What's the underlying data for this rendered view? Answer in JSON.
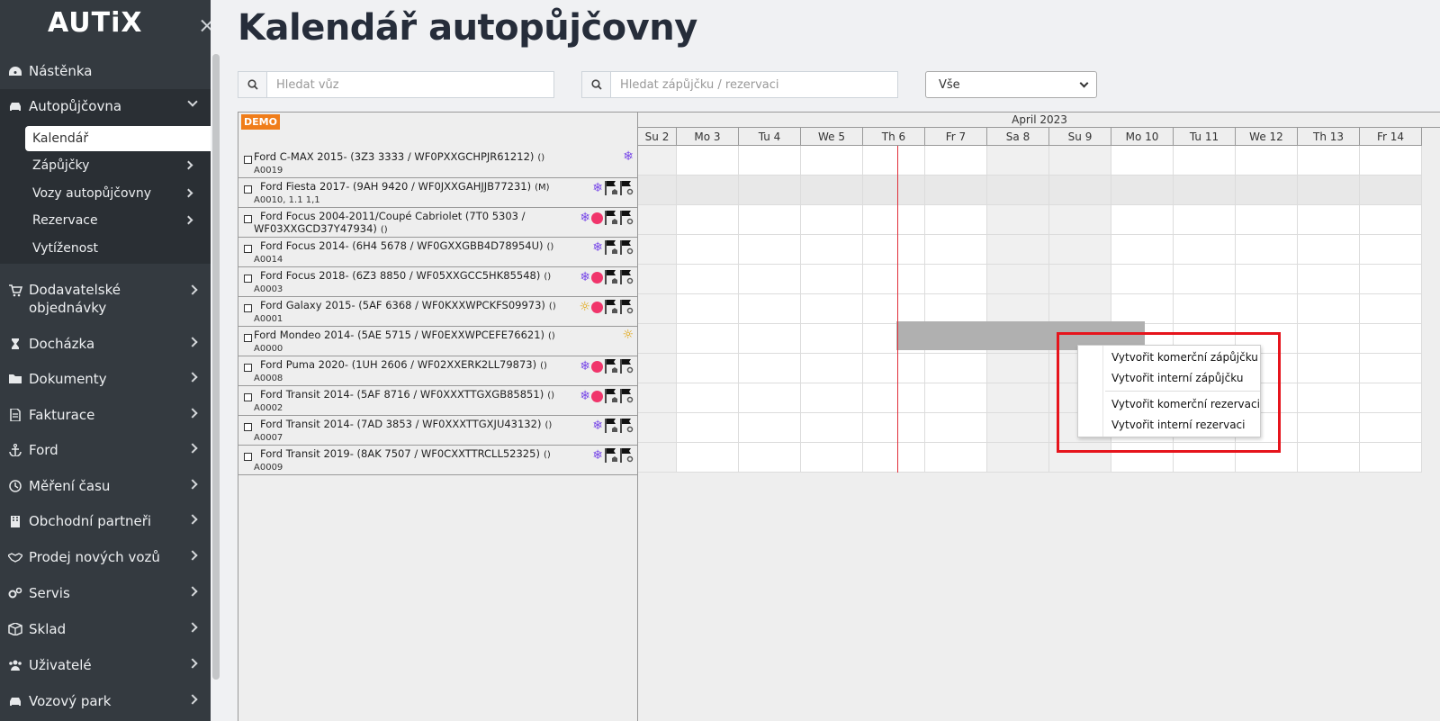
{
  "sidebar": {
    "logo": "AUTiX",
    "items": [
      {
        "label": "Nástěnka",
        "icon": "gauge-icon"
      },
      {
        "label": "Autopůjčovna",
        "icon": "car-icon"
      },
      {
        "label": "Dodavatelské objednávky",
        "icon": "cart-icon"
      },
      {
        "label": "Docházka",
        "icon": "hourglass-icon"
      },
      {
        "label": "Dokumenty",
        "icon": "folder-icon"
      },
      {
        "label": "Fakturace",
        "icon": "document-icon"
      },
      {
        "label": "Ford",
        "icon": "anchor-icon"
      },
      {
        "label": "Měření času",
        "icon": "clock-icon"
      },
      {
        "label": "Obchodní partneři",
        "icon": "building-icon"
      },
      {
        "label": "Prodej nových vozů",
        "icon": "handshake-icon"
      },
      {
        "label": "Servis",
        "icon": "gears-icon"
      },
      {
        "label": "Sklad",
        "icon": "box-icon"
      },
      {
        "label": "Uživatelé",
        "icon": "users-icon"
      },
      {
        "label": "Vozový park",
        "icon": "car-icon"
      }
    ],
    "sub_items": [
      {
        "label": "Kalendář"
      },
      {
        "label": "Zápůjčky"
      },
      {
        "label": "Vozy autopůjčovny"
      },
      {
        "label": "Rezervace"
      },
      {
        "label": "Vytíženost"
      }
    ]
  },
  "page": {
    "title": "Kalendář autopůjčovny"
  },
  "search": {
    "car_placeholder": "Hledat vůz",
    "loan_placeholder": "Hledat zápůjčku / rezervaci",
    "filter_value": "Vše"
  },
  "calendar": {
    "demo_label": "DEMO",
    "month": "April 2023",
    "days": [
      "Su 2",
      "Mo 3",
      "Tu 4",
      "We 5",
      "Th 6",
      "Fr 7",
      "Sa 8",
      "Su 9",
      "Mo 10",
      "Tu 11",
      "We 12",
      "Th 13",
      "Fr 14"
    ],
    "cars": [
      {
        "name": "Ford C-MAX 2015- (3Z3 3333 / WF0PXXGCHPJR61212)",
        "suffix": "()",
        "code": "A0019",
        "icons": [
          "snowflake-icon"
        ]
      },
      {
        "name": "Ford Fiesta 2017- (9AH 9420 / WF0JXXGAHJJB77231)",
        "suffix": "(M)",
        "code": "A0010, 1.1 1,1",
        "icons": [
          "snowflake-icon",
          "flag-home-icon",
          "flag-gear-icon"
        ]
      },
      {
        "name": "Ford Focus 2004-2011/Coupé Cabriolet (7T0 5303 /",
        "name2": "WF03XXGCD37Y47934)",
        "suffix": "()",
        "code": "",
        "icons": [
          "snowflake-icon",
          "red-dot-icon",
          "flag-home-icon",
          "flag-gear-icon"
        ]
      },
      {
        "name": "Ford Focus 2014- (6H4 5678 / WF0GXXGBB4D78954U)",
        "suffix": "()",
        "code": "A0014",
        "icons": [
          "snowflake-icon",
          "flag-home-icon",
          "flag-gear-icon"
        ]
      },
      {
        "name": "Ford Focus 2018- (6Z3 8850 / WF05XXGCC5HK85548)",
        "suffix": "()",
        "code": "A0003",
        "icons": [
          "snowflake-icon",
          "red-dot-icon",
          "flag-home-icon",
          "flag-gear-icon"
        ]
      },
      {
        "name": "Ford Galaxy 2015- (5AF 6368 / WF0KXXWPCKFS09973)",
        "suffix": "()",
        "code": "A0001",
        "icons": [
          "sun-icon",
          "red-dot-icon",
          "flag-home-icon",
          "flag-gear-icon"
        ]
      },
      {
        "name": "Ford Mondeo 2014- (5AE 5715 / WF0EXXWPCEFE76621)",
        "suffix": "()",
        "code": "A0000",
        "icons": [
          "sun-icon"
        ]
      },
      {
        "name": "Ford Puma 2020- (1UH 2606 / WF02XXERK2LL79873)",
        "suffix": "()",
        "code": "A0008",
        "icons": [
          "snowflake-icon",
          "red-dot-icon",
          "flag-home-icon",
          "flag-gear-icon"
        ]
      },
      {
        "name": "Ford Transit 2014- (5AF 8716 / WF0XXXTTGXGB85851)",
        "suffix": "()",
        "code": "A0002",
        "icons": [
          "snowflake-icon",
          "red-dot-icon",
          "flag-home-icon",
          "flag-gear-icon"
        ]
      },
      {
        "name": "Ford Transit 2014- (7AD 3853 / WF0XXXTTGXJU43132)",
        "suffix": "()",
        "code": "A0007",
        "icons": [
          "snowflake-icon",
          "flag-home-icon",
          "flag-gear-icon"
        ]
      },
      {
        "name": "Ford Transit 2019- (8AK 7507 / WF0CXXTTRCLL52325)",
        "suffix": "()",
        "code": "A0009",
        "icons": [
          "snowflake-icon",
          "flag-home-icon",
          "flag-gear-icon"
        ]
      }
    ]
  },
  "context_menu": {
    "items": [
      {
        "label": "Vytvořit komerční zápůjčku"
      },
      {
        "label": "Vytvořit interní zápůjčku"
      },
      {
        "label": "Vytvořit komerční rezervaci"
      },
      {
        "label": "Vytvořit interní rezervaci"
      }
    ]
  },
  "colors": {
    "sidebar_bg": "#343a40",
    "today_line": "#e0303a",
    "highlight": "#e6141c",
    "demo_badge": "#f07d1a",
    "snowflake": "#7a4be8",
    "red_dot": "#f0356b"
  }
}
